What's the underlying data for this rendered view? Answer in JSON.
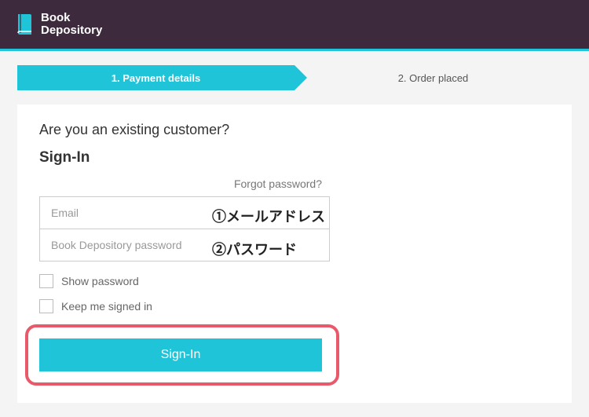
{
  "brand": {
    "line1": "Book",
    "line2": "Depository"
  },
  "steps": {
    "step1": "1. Payment details",
    "step2": "2. Order placed"
  },
  "card": {
    "question": "Are you an existing customer?",
    "heading": "Sign-In",
    "forgot": "Forgot password?",
    "email_placeholder": "Email",
    "password_placeholder": "Book Depository password",
    "show_password": "Show password",
    "keep_signed": "Keep me signed in",
    "signin_button": "Sign-In"
  },
  "annotations": {
    "email": "①メールアドレス",
    "password": "②パスワード"
  },
  "colors": {
    "accent": "#1fc4d8",
    "header": "#3d2b3d",
    "highlight": "#e85a6a"
  }
}
